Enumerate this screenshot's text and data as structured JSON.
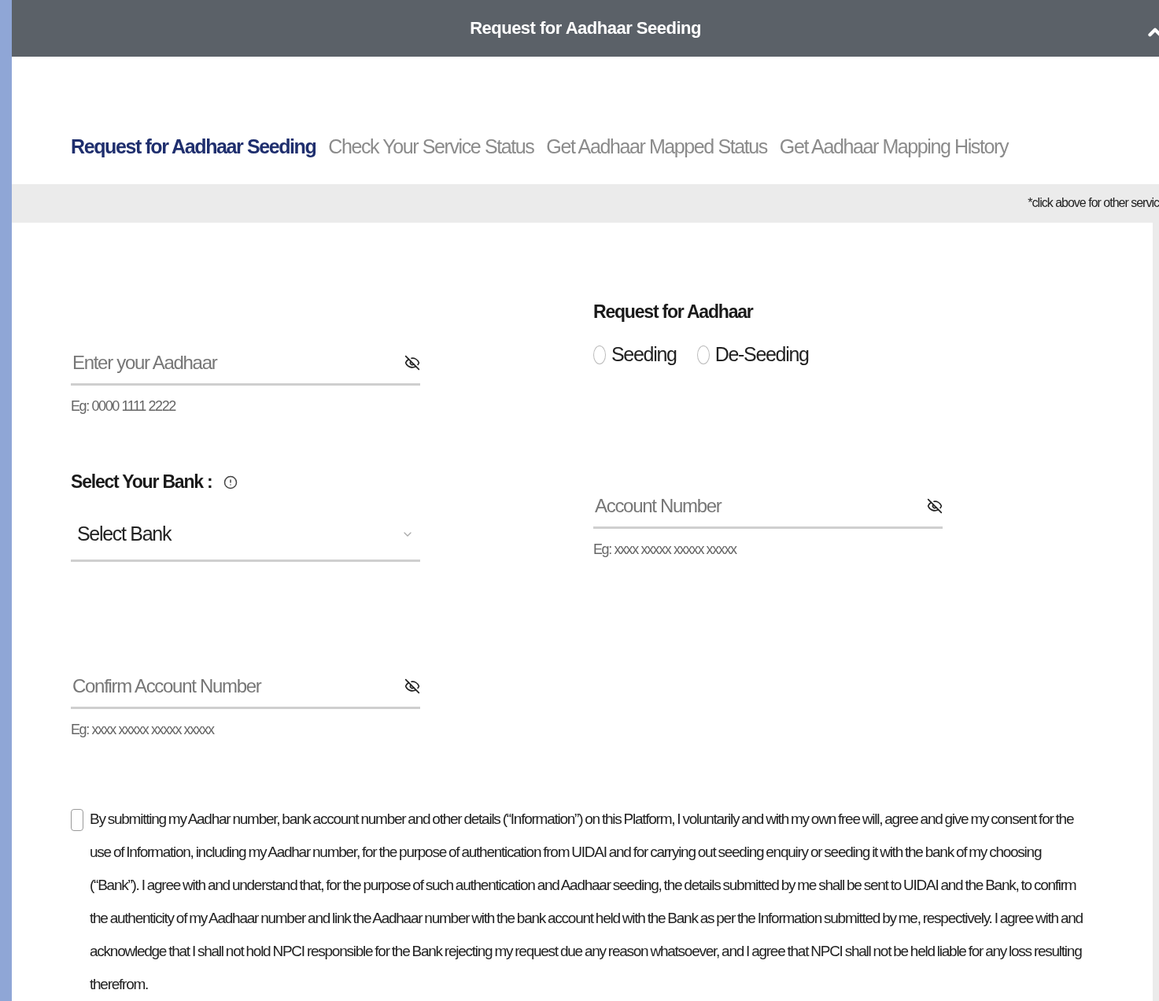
{
  "header": {
    "title": "Request for Aadhaar Seeding"
  },
  "tabs": [
    {
      "label": "Request for Aadhaar Seeding",
      "selected": true
    },
    {
      "label": "Check Your Service Status",
      "selected": false
    },
    {
      "label": "Get Aadhaar Mapped Status",
      "selected": false
    },
    {
      "label": "Get Aadhaar Mapping History",
      "selected": false
    }
  ],
  "hint_band": {
    "text": "*click above for other servic"
  },
  "aadhaar_field": {
    "placeholder": "Enter your Aadhaar",
    "example": "Eg: 0000 1111 2222"
  },
  "bank": {
    "label": "Select Your Bank :",
    "select_value": "Select Bank"
  },
  "confirm_account_field": {
    "placeholder": "Confirm Account Number",
    "example": "Eg: xxxx xxxxx xxxxx xxxxx"
  },
  "request_type": {
    "label": "Request for Aadhaar",
    "options": [
      {
        "label": "Seeding",
        "selected": false
      },
      {
        "label": "De-Seeding",
        "selected": false
      }
    ]
  },
  "account_field": {
    "placeholder": "Account Number",
    "example": "Eg: xxxx xxxxx xxxxx xxxxx"
  },
  "consent": {
    "checked": false,
    "text": "By submitting my Aadhar number, bank account number and other details (“Information”) on this Platform, I voluntarily and with my own free will, agree and give my consent for the use of Information, including my Aadhar number, for the purpose of authentication from UIDAI and for carrying out seeding enquiry or seeding it with the bank of my choosing (“Bank”). I agree with and understand that, for the purpose of such authentication and Aadhaar seeding, the details submitted by me shall be sent to UIDAI and the Bank, to confirm the authenticity of my Aadhaar number and link the Aadhaar number with the bank account held with the Bank as per the Information submitted by me, respectively. I agree with and acknowledge that I shall not hold NPCI responsible for the Bank rejecting my request due any reason whatsoever, and I agree that NPCI shall not be held liable for any loss resulting therefrom."
  }
}
